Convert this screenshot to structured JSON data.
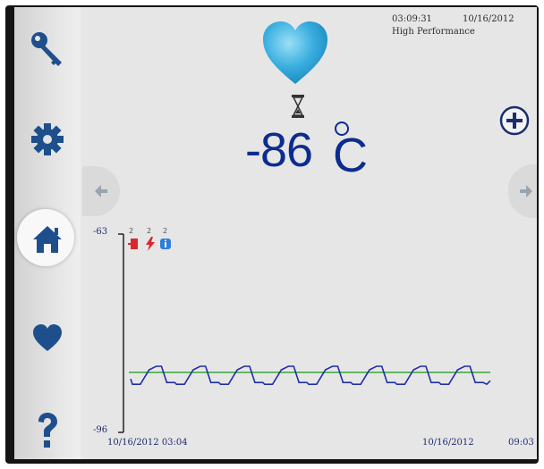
{
  "status": {
    "time": "03:09:31",
    "date": "10/16/2012",
    "mode": "High Performance"
  },
  "sidebar": {
    "items": [
      {
        "icon": "key-icon"
      },
      {
        "icon": "gear-icon"
      },
      {
        "icon": "home-icon",
        "active": true
      },
      {
        "icon": "heart-icon"
      },
      {
        "icon": "question-icon"
      }
    ]
  },
  "main": {
    "temperature_value": "-86",
    "temperature_unit": "C",
    "status_icon": "heart-icon",
    "timer_icon": "hourglass-icon"
  },
  "events": {
    "door": {
      "count": "2",
      "icon": "door-icon",
      "color": "#d8282d"
    },
    "power": {
      "count": "2",
      "icon": "lightning-icon",
      "color": "#d8282d"
    },
    "info": {
      "count": "2",
      "icon": "info-icon",
      "color": "#2f7fd8"
    }
  },
  "chart_data": {
    "type": "line",
    "ylim": [
      -96,
      -63
    ],
    "ytick_labels": [
      "-63",
      "-96"
    ],
    "x_start_label": "10/16/2012  03:04",
    "x_end_date_label": "10/16/2012",
    "x_end_time_label": "09:03",
    "setpoint": -86,
    "series": [
      {
        "color": "#1f2fa8",
        "cycles": 8,
        "min": -88,
        "max": -85
      }
    ],
    "setpoint_color": "#3aa63a"
  },
  "colors": {
    "accent": "#0d2c8f",
    "sidebar_icon": "#1e4f8c",
    "heart": "#2aa3d8"
  }
}
